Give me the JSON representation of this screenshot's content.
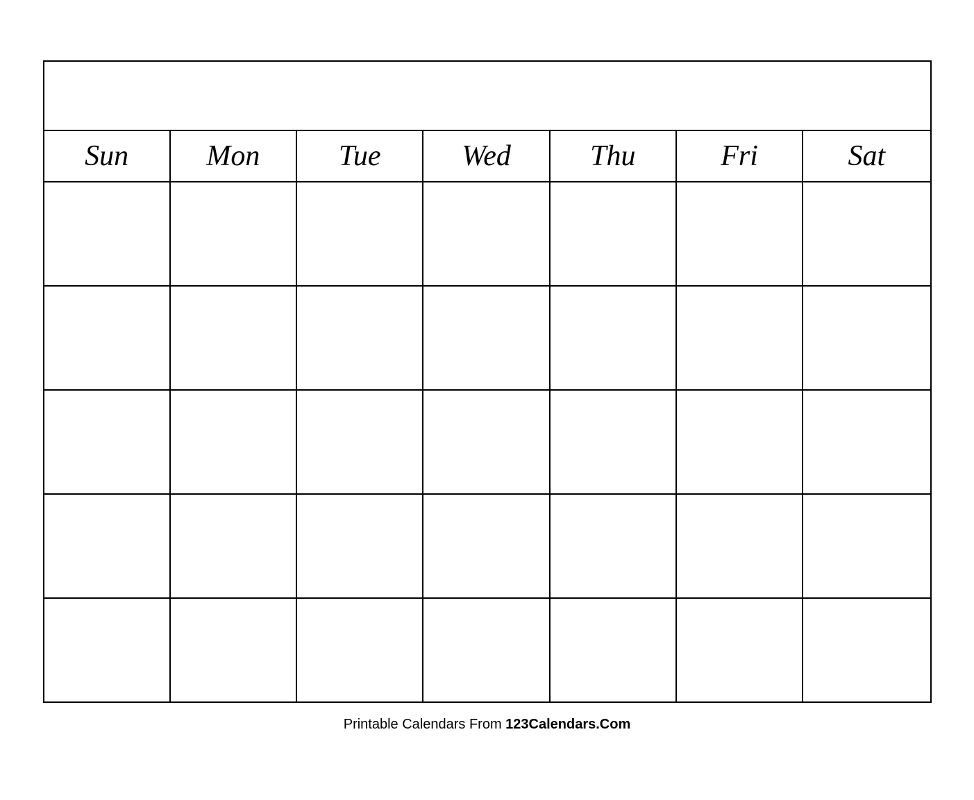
{
  "calendar": {
    "title": "",
    "days": [
      "Sun",
      "Mon",
      "Tue",
      "Wed",
      "Thu",
      "Fri",
      "Sat"
    ],
    "rows": 5
  },
  "footer": {
    "text_normal": "Printable Calendars From ",
    "text_bold": "123Calendars.Com"
  }
}
